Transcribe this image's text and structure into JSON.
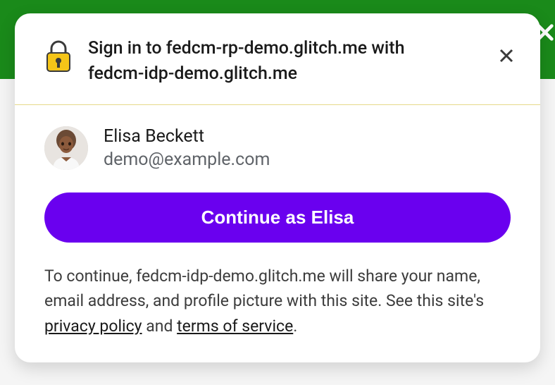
{
  "header": {
    "title_line1": "Sign in to fedcm-rp-demo.glitch.me with",
    "title_line2": "fedcm-idp-demo.glitch.me"
  },
  "account": {
    "name": "Elisa Beckett",
    "email": "demo@example.com"
  },
  "continue_button_label": "Continue as Elisa",
  "disclosure": {
    "pre": "To continue, fedcm-idp-demo.glitch.me will share your name, email address, and profile picture with this site. See this site's ",
    "privacy_label": "privacy policy",
    "mid": " and ",
    "terms_label": "terms of service",
    "post": "."
  },
  "icons": {
    "lock": "lock-icon",
    "close": "close-icon"
  },
  "colors": {
    "accent": "#6a00ef",
    "top_bar": "#1a8a1a"
  }
}
